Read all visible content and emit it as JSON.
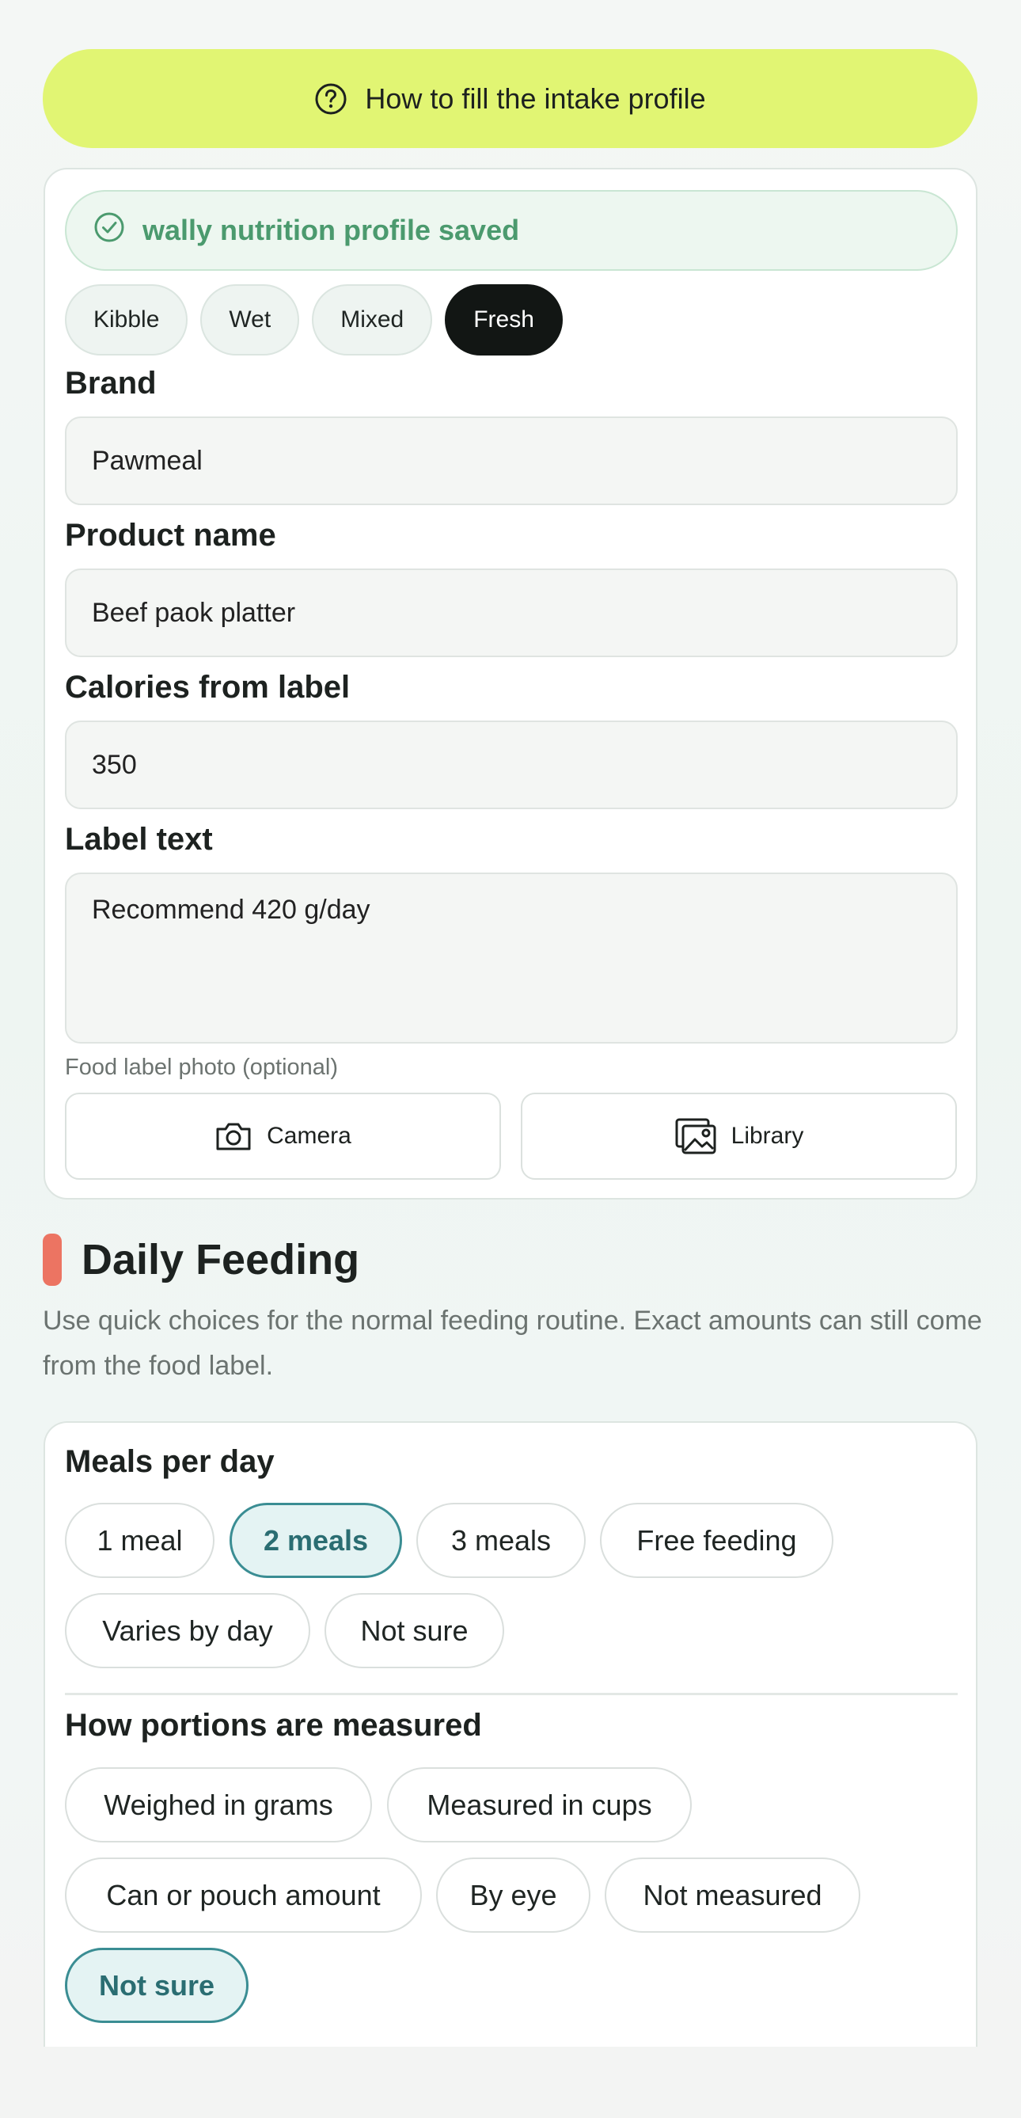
{
  "help": {
    "label": "How to fill the intake profile",
    "icon": "question-circle-icon"
  },
  "profile": {
    "saved_message": "wally nutrition profile saved",
    "food_types": [
      "Kibble",
      "Wet",
      "Mixed",
      "Fresh"
    ],
    "selected_food_type": "Fresh",
    "brand_label": "Brand",
    "brand_value": "Pawmeal",
    "product_label": "Product name",
    "product_value": "Beef paok platter",
    "calories_label": "Calories from label",
    "calories_value": "350",
    "label_text_label": "Label text",
    "label_text_value": "Recommend 420 g/day",
    "photo_caption": "Food label photo (optional)",
    "camera_label": "Camera",
    "library_label": "Library"
  },
  "daily_feeding": {
    "title": "Daily Feeding",
    "description": "Use quick choices for the normal feeding routine. Exact amounts can still come from the food label.",
    "meals_title": "Meals per day",
    "meals_options": [
      "1 meal",
      "2 meals",
      "3 meals",
      "Free feeding",
      "Varies by day",
      "Not sure"
    ],
    "meals_selected": "2 meals",
    "portions_title": "How portions are measured",
    "portion_options": [
      "Weighed in grams",
      "Measured in cups",
      "Can or pouch amount",
      "By eye",
      "Not measured",
      "Not sure"
    ],
    "portion_selected": "Not sure"
  },
  "colors": {
    "help_button": "#e1f573",
    "saved_green": "#4b9a6e",
    "section_accent": "#ec7462",
    "selected_chip_border": "#3a8d93",
    "dark_chip": "#121614"
  }
}
